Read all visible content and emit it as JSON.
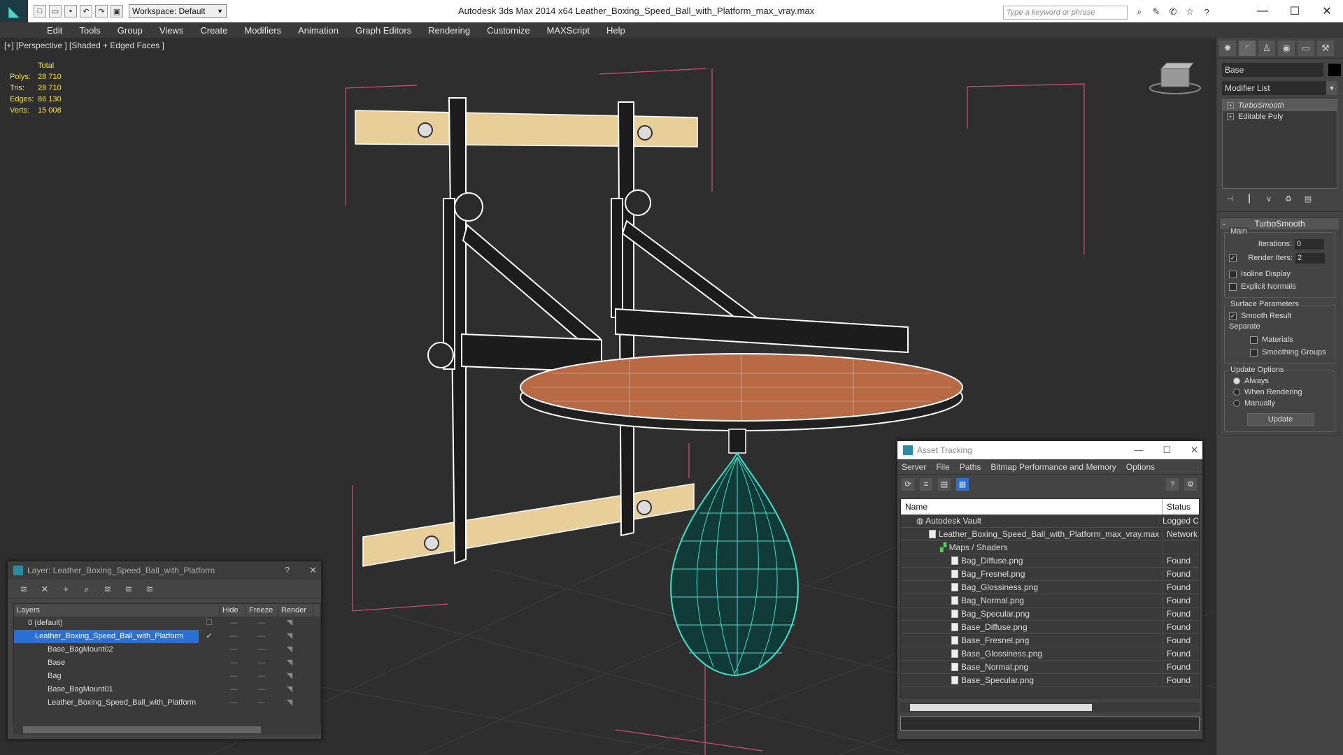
{
  "titlebar": {
    "workspace": "Workspace: Default",
    "title": "Autodesk 3ds Max  2014 x64     Leather_Boxing_Speed_Ball_with_Platform_max_vray.max",
    "search_placeholder": "Type a keyword or phrase"
  },
  "menu": [
    "Edit",
    "Tools",
    "Group",
    "Views",
    "Create",
    "Modifiers",
    "Animation",
    "Graph Editors",
    "Rendering",
    "Customize",
    "MAXScript",
    "Help"
  ],
  "viewport": {
    "label": "[+] [Perspective ] [Shaded + Edged Faces ]",
    "stats": {
      "header": "Total",
      "rows": [
        {
          "k": "Polys:",
          "v": "28 710"
        },
        {
          "k": "Tris:",
          "v": "28 710"
        },
        {
          "k": "Edges:",
          "v": "86 130"
        },
        {
          "k": "Verts:",
          "v": "15 008"
        }
      ]
    }
  },
  "command_panel": {
    "object_name": "Base",
    "modifier_list": "Modifier List",
    "stack": [
      "TurboSmooth",
      "Editable Poly"
    ],
    "rollout_title": "TurboSmooth",
    "main_label": "Main",
    "iterations_label": "Iterations:",
    "iterations_value": "0",
    "render_iters_label": "Render Iters:",
    "render_iters_value": "2",
    "isoline": "Isoline Display",
    "explicit_normals": "Explicit Normals",
    "surface_params": "Surface Parameters",
    "smooth_result": "Smooth Result",
    "separate": "Separate",
    "materials": "Materials",
    "smoothing_groups": "Smoothing Groups",
    "update_options": "Update Options",
    "always": "Always",
    "when_rendering": "When Rendering",
    "manually": "Manually",
    "update_btn": "Update"
  },
  "layer_dialog": {
    "title": "Layer: Leather_Boxing_Speed_Ball_with_Platform",
    "help": "?",
    "close": "✕",
    "cols": {
      "layers": "Layers",
      "hide": "Hide",
      "freeze": "Freeze",
      "render": "Render"
    },
    "rows": [
      {
        "name": "0 (default)"
      },
      {
        "name": "Leather_Boxing_Speed_Ball_with_Platform"
      },
      {
        "name": "Base_BagMount02"
      },
      {
        "name": "Base"
      },
      {
        "name": "Bag"
      },
      {
        "name": "Base_BagMount01"
      },
      {
        "name": "Leather_Boxing_Speed_Ball_with_Platform"
      }
    ]
  },
  "asset_dialog": {
    "title": "Asset Tracking",
    "menu": [
      "Server",
      "File",
      "Paths",
      "Bitmap Performance and Memory",
      "Options"
    ],
    "col_name": "Name",
    "col_status": "Status",
    "rows": [
      {
        "name": "Autodesk Vault",
        "status": "Logged C"
      },
      {
        "name": "Leather_Boxing_Speed_Ball_with_Platform_max_vray.max",
        "status": "Network"
      },
      {
        "name": "Maps / Shaders",
        "status": ""
      },
      {
        "name": "Bag_Diffuse.png",
        "status": "Found"
      },
      {
        "name": "Bag_Fresnel.png",
        "status": "Found"
      },
      {
        "name": "Bag_Glossiness.png",
        "status": "Found"
      },
      {
        "name": "Bag_Normal.png",
        "status": "Found"
      },
      {
        "name": "Bag_Specular.png",
        "status": "Found"
      },
      {
        "name": "Base_Diffuse.png",
        "status": "Found"
      },
      {
        "name": "Base_Fresnel.png",
        "status": "Found"
      },
      {
        "name": "Base_Glossiness.png",
        "status": "Found"
      },
      {
        "name": "Base_Normal.png",
        "status": "Found"
      },
      {
        "name": "Base_Specular.png",
        "status": "Found"
      }
    ]
  },
  "colors": {
    "accent": "#2a6fd6",
    "stats": "#f0e050",
    "bag_wire": "#3fe0c8"
  }
}
